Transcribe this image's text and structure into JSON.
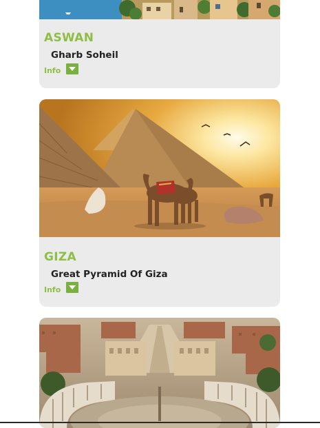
{
  "cards": [
    {
      "city": "ASWAN",
      "place": "Gharb Soheil",
      "info_label": "Info",
      "toggle_icon": "chevron-down-icon"
    },
    {
      "city": "GIZA",
      "place": "Great Pyramid Of Giza",
      "info_label": "Info",
      "toggle_icon": "chevron-down-icon"
    },
    {
      "city": "",
      "place": "",
      "info_label": ""
    }
  ],
  "colors": {
    "accent": "#8dbf45",
    "toggle": "#7ab03f",
    "card_bg": "#ebebeb",
    "place_text": "#222222"
  }
}
